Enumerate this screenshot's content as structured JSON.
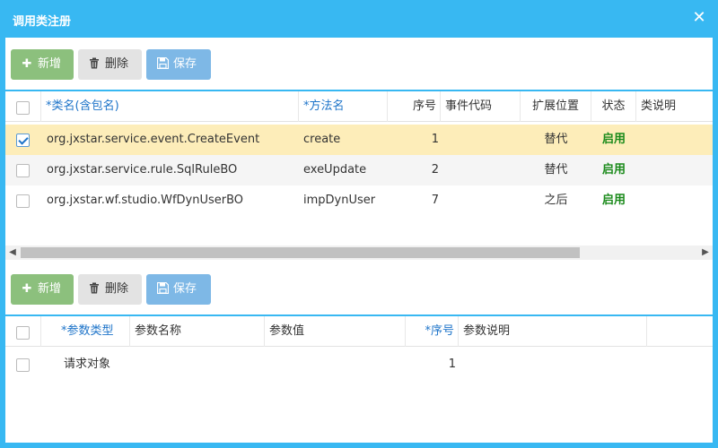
{
  "window": {
    "title": "调用类注册"
  },
  "toolbar_top": {
    "add": "新增",
    "delete": "删除",
    "save": "保存"
  },
  "grid_top": {
    "headers": [
      "*类名(含包名)",
      "*方法名",
      "序号",
      "事件代码",
      "扩展位置",
      "状态",
      "类说明"
    ],
    "rows": [
      {
        "checked": true,
        "class": "org.jxstar.service.event.CreateEvent",
        "method": "create",
        "seq": "1",
        "event_code": "",
        "position": "替代",
        "status": "启用",
        "desc": ""
      },
      {
        "checked": false,
        "class": "org.jxstar.service.rule.SqlRuleBO",
        "method": "exeUpdate",
        "seq": "2",
        "event_code": "",
        "position": "替代",
        "status": "启用",
        "desc": ""
      },
      {
        "checked": false,
        "class": "org.jxstar.wf.studio.WfDynUserBO",
        "method": "impDynUser",
        "seq": "7",
        "event_code": "",
        "position": "之后",
        "status": "启用",
        "desc": ""
      }
    ]
  },
  "toolbar_bottom": {
    "add": "新增",
    "delete": "删除",
    "save": "保存"
  },
  "grid_bottom": {
    "headers": [
      "*参数类型",
      "参数名称",
      "参数值",
      "*序号",
      "参数说明"
    ],
    "rows": [
      {
        "checked": false,
        "type": "请求对象",
        "name": "",
        "value": "",
        "seq": "1",
        "desc": ""
      }
    ]
  },
  "icons": {
    "add": "plus-icon",
    "delete": "trash-icon",
    "save": "floppy-disk-icon",
    "close": "close-icon"
  },
  "colors": {
    "accent": "#38b8f2",
    "add_button": "#8cc07d",
    "save_button": "#7eb8e6",
    "selected_row": "#fdedb9",
    "status_green": "#1a8a1a",
    "required_header": "#1e74c9"
  }
}
